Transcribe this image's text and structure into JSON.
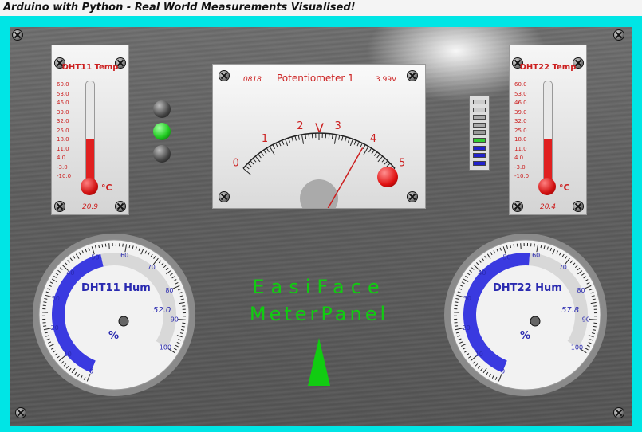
{
  "window": {
    "title": "Arduino with Python - Real World Measurements Visualised!"
  },
  "dht11_temp": {
    "title": "DHT11 Temp",
    "unit": "°C",
    "value": "20.9",
    "level_fraction": 0.44,
    "scale": [
      "60.0",
      "53.0",
      "46.0",
      "39.0",
      "32.0",
      "25.0",
      "18.0",
      "11.0",
      "4.0",
      "-3.0",
      "-10.0"
    ]
  },
  "dht22_temp": {
    "title": "DHT22 Temp",
    "unit": "°C",
    "value": "20.4",
    "level_fraction": 0.44,
    "scale": [
      "60.0",
      "53.0",
      "46.0",
      "39.0",
      "32.0",
      "25.0",
      "18.0",
      "11.0",
      "4.0",
      "-3.0",
      "-10.0"
    ]
  },
  "potentiometer": {
    "title": "Potentiometer 1",
    "counter": "0818",
    "reading": "3.99V",
    "unit": "V",
    "value": 3.99,
    "range": [
      0,
      5
    ],
    "major_labels": [
      "0",
      "1",
      "2",
      "3",
      "4",
      "5"
    ]
  },
  "traffic_light": {
    "states": [
      "off",
      "green",
      "off"
    ],
    "colors": {
      "green": "#22cc22",
      "off": "#444444"
    }
  },
  "bar_indicator": {
    "segments": [
      "#cccccc",
      "#cccccc",
      "#aaaaaa",
      "#aaaaaa",
      "#999999",
      "#33cc33",
      "#2222cc",
      "#2222cc",
      "#2222cc"
    ]
  },
  "dht11_hum": {
    "title": "DHT11 Hum",
    "value": "52.0",
    "unit": "%",
    "numeric": 52.0,
    "labels": [
      "0",
      "10",
      "20",
      "30",
      "40",
      "50",
      "60",
      "70",
      "80",
      "90",
      "100"
    ]
  },
  "dht22_hum": {
    "title": "DHT22 Hum",
    "value": "57.8",
    "unit": "%",
    "numeric": 57.8,
    "labels": [
      "0",
      "10",
      "20",
      "30",
      "40",
      "50",
      "60",
      "70",
      "80",
      "90",
      "100"
    ]
  },
  "brand": {
    "line1": "EasiFace",
    "line2": "MeterPanel"
  },
  "colors": {
    "frame": "#00e5e5",
    "temp_red": "#cc2020",
    "gauge_blue": "#3a3ae0",
    "brand_green": "#11cc11"
  }
}
